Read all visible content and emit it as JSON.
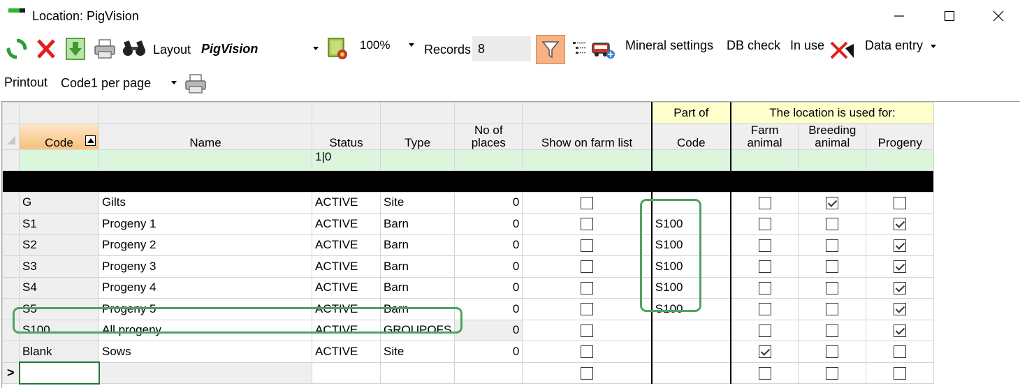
{
  "window": {
    "title": "Location: PigVision"
  },
  "toolbar": {
    "layout_label": "Layout",
    "layout_value": "PigVision",
    "zoom_value": "100%",
    "records_label": "Records",
    "records_value": "8",
    "mineral_settings": "Mineral settings",
    "db_check": "DB check",
    "in_use": "In use",
    "data_entry": "Data entry",
    "printout_label": "Printout",
    "printout_value": "Code1 per page"
  },
  "grid": {
    "group_headers": {
      "part_of": "Part of",
      "used_for": "The location is used for:"
    },
    "columns": {
      "code": "Code",
      "name": "Name",
      "status": "Status",
      "type": "Type",
      "no_of_places_1": "No of",
      "no_of_places_2": "places",
      "show_on_farm_list": "Show on farm list",
      "part_code": "Code",
      "farm_animal_1": "Farm",
      "farm_animal_2": "animal",
      "breeding_animal_1": "Breeding",
      "breeding_animal_2": "animal",
      "progeny": "Progeny"
    },
    "filter": {
      "status": "1|0"
    },
    "new_row_marker": ">",
    "rows": [
      {
        "code": "G",
        "name": "Gilts",
        "status": "ACTIVE",
        "type": "Site",
        "places": "0",
        "show": false,
        "part": "",
        "farm": false,
        "breeding": true,
        "progeny": false
      },
      {
        "code": "S1",
        "name": "Progeny 1",
        "status": "ACTIVE",
        "type": "Barn",
        "places": "0",
        "show": false,
        "part": "S100",
        "farm": false,
        "breeding": false,
        "progeny": true
      },
      {
        "code": "S2",
        "name": "Progeny 2",
        "status": "ACTIVE",
        "type": "Barn",
        "places": "0",
        "show": false,
        "part": "S100",
        "farm": false,
        "breeding": false,
        "progeny": true
      },
      {
        "code": "S3",
        "name": "Progeny 3",
        "status": "ACTIVE",
        "type": "Barn",
        "places": "0",
        "show": false,
        "part": "S100",
        "farm": false,
        "breeding": false,
        "progeny": true
      },
      {
        "code": "S4",
        "name": "Progeny 4",
        "status": "ACTIVE",
        "type": "Barn",
        "places": "0",
        "show": false,
        "part": "S100",
        "farm": false,
        "breeding": false,
        "progeny": true
      },
      {
        "code": "S5",
        "name": "Progeny 5",
        "status": "ACTIVE",
        "type": "Barn",
        "places": "0",
        "show": false,
        "part": "S100",
        "farm": false,
        "breeding": false,
        "progeny": true
      },
      {
        "code": "S100",
        "name": "All progeny",
        "status": "ACTIVE",
        "type": "GROUPOFS",
        "places": "0",
        "show": false,
        "part": "",
        "farm": false,
        "breeding": false,
        "progeny": true
      },
      {
        "code": "Blank",
        "name": "Sows",
        "status": "ACTIVE",
        "type": "Site",
        "places": "0",
        "show": false,
        "part": "",
        "farm": true,
        "breeding": false,
        "progeny": false
      }
    ]
  },
  "colors": {
    "accent_highlight": "#4ea360",
    "filter_row": "#dbf6dc",
    "part_of_header": "#ffffcc",
    "sort_header": "#f7c07a"
  }
}
